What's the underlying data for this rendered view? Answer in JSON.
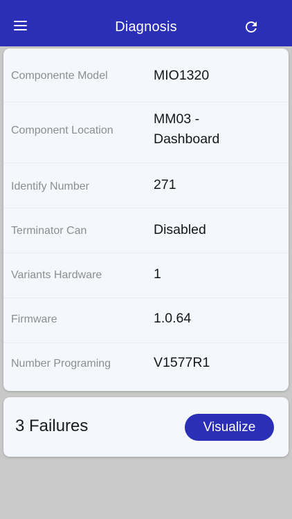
{
  "header": {
    "title": "Diagnosis",
    "background_color": "#2b2fb8",
    "menu_icon": "menu-icon",
    "refresh_icon": "refresh-icon"
  },
  "details": [
    {
      "label": "Componente Model",
      "value": "MIO1320"
    },
    {
      "label": "Component Location",
      "value": "MM03 - Dashboard"
    },
    {
      "label": "Identify Number",
      "value": "271"
    },
    {
      "label": "Terminator Can",
      "value": "Disabled"
    },
    {
      "label": "Variants Hardware",
      "value": "1"
    },
    {
      "label": "Firmware",
      "value": "1.0.64"
    },
    {
      "label": "Number Programing",
      "value": "V1577R1"
    }
  ],
  "failures": {
    "text": "3 Failures",
    "button_label": "Visualize",
    "button_color": "#2b2fb8"
  }
}
